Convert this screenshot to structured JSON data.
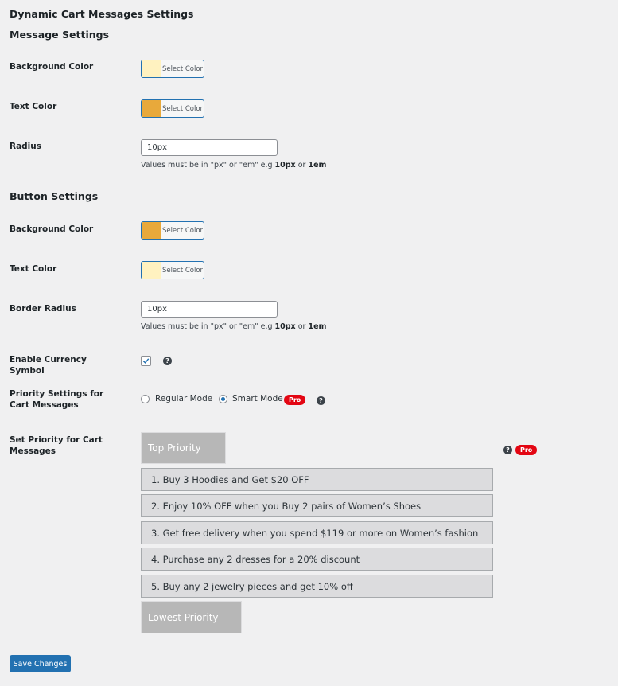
{
  "page_title": "Dynamic Cart Messages Settings",
  "message_settings": {
    "heading": "Message Settings",
    "background_color": {
      "label": "Background Color",
      "button_label": "Select Color",
      "swatch": "#fff2c0"
    },
    "text_color": {
      "label": "Text Color",
      "button_label": "Select Color",
      "swatch": "#e8a93b"
    },
    "radius": {
      "label": "Radius",
      "value": "10px",
      "hint_prefix": "Values must be in \"px\" or \"em\" e.g ",
      "hint_ex1": "10px",
      "hint_or": " or ",
      "hint_ex2": "1em"
    }
  },
  "button_settings": {
    "heading": "Button Settings",
    "background_color": {
      "label": "Background Color",
      "button_label": "Select Color",
      "swatch": "#e8a93b"
    },
    "text_color": {
      "label": "Text Color",
      "button_label": "Select Color",
      "swatch": "#fff2c0"
    },
    "border_radius": {
      "label": "Border Radius",
      "value": "10px",
      "hint_prefix": "Values must be in \"px\" or \"em\" e.g ",
      "hint_ex1": "10px",
      "hint_or": " or ",
      "hint_ex2": "1em"
    }
  },
  "currency": {
    "label": "Enable Currency Symbol",
    "checked": true,
    "help": "?"
  },
  "priority_mode": {
    "label": "Priority Settings for Cart Messages",
    "options": [
      {
        "label": "Regular Mode",
        "selected": false
      },
      {
        "label": "Smart Mode",
        "selected": true,
        "badge": "Pro"
      }
    ],
    "help": "?"
  },
  "priority_list": {
    "label": "Set Priority for Cart Messages",
    "top_label": "Top Priority",
    "bottom_label": "Lowest Priority",
    "badge": "Pro",
    "help": "?",
    "items": [
      "1. Buy 3 Hoodies and Get $20 OFF",
      "2. Enjoy 10% OFF when you Buy 2 pairs of Women’s Shoes",
      "3. Get free delivery when you spend $119 or more on Women’s fashion",
      "4. Purchase any 2 dresses for a 20% discount",
      "5. Buy any 2 jewelry pieces and get 10% off"
    ]
  },
  "save_button": "Save Changes"
}
